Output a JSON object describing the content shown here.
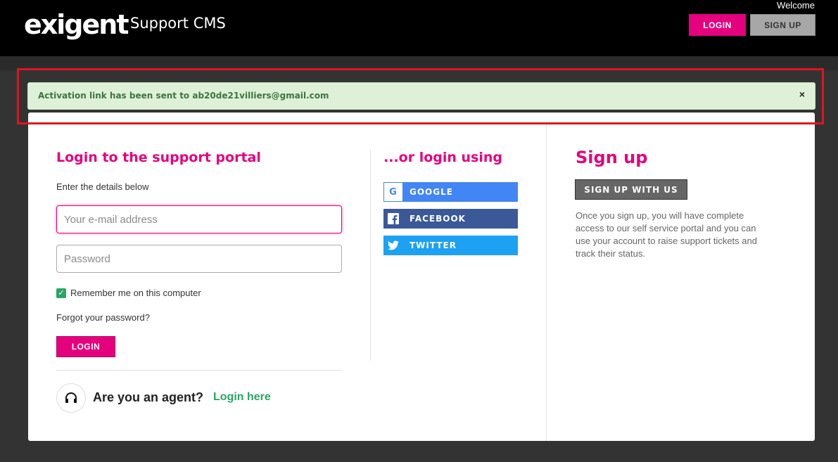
{
  "header": {
    "logo_text": "exigent",
    "app_title": "Support CMS",
    "welcome": "Welcome",
    "login_label": "LOGIN",
    "signup_label": "SIGN UP"
  },
  "alert": {
    "message": "Activation link has been sent to ab20de21villiers@gmail.com",
    "close_label": "×"
  },
  "login": {
    "heading": "Login to the support portal",
    "subheading": "Enter the details below",
    "email_placeholder": "Your e-mail address",
    "password_placeholder": "Password",
    "remember_label": "Remember me on this computer",
    "remember_checked": true,
    "forgot_label": "Forgot your password?",
    "submit_label": "LOGIN"
  },
  "agent": {
    "question": "Are you an agent?",
    "link_label": "Login here"
  },
  "social": {
    "heading": "...or login using",
    "google_label": "GOOGLE",
    "facebook_label": "FACEBOOK",
    "twitter_label": "TWITTER"
  },
  "signup": {
    "heading": "Sign up",
    "button_label": "SIGN UP WITH US",
    "description": "Once you sign up, you will have complete access to our self service portal and you can use your account to raise support tickets and track their status."
  },
  "colors": {
    "brand": "#e5007e",
    "success_bg": "#dff0d8",
    "success_text": "#3c763d",
    "agent_link": "#2aa564"
  }
}
